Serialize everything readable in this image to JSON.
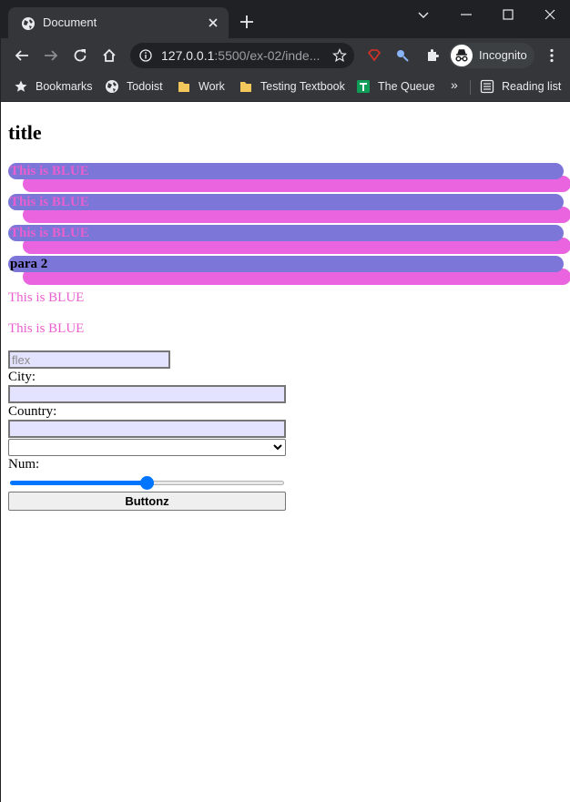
{
  "browser": {
    "tab_title": "Document",
    "url_host": "127.0.0.1",
    "url_rest": ":5500/ex-02/inde...",
    "profile_label": "Incognito",
    "bookmarks": [
      {
        "label": "Bookmarks",
        "icon": "star-icon"
      },
      {
        "label": "Todoist",
        "icon": "globe-icon"
      },
      {
        "label": "Work",
        "icon": "folder-icon"
      },
      {
        "label": "Testing Textbook",
        "icon": "folder-icon"
      },
      {
        "label": "The Queue",
        "icon": "sheets-icon"
      }
    ],
    "more_label": "»",
    "reading_list_label": "Reading list"
  },
  "page": {
    "title": "title",
    "highlight_rows": [
      {
        "text": "This is BLUE"
      },
      {
        "text": "This is BLUE"
      },
      {
        "text": "This is BLUE"
      },
      {
        "text": "para 2"
      }
    ],
    "plain_rows": [
      {
        "text": "This is BLUE"
      },
      {
        "text": "This is BLUE"
      }
    ],
    "form": {
      "flex_placeholder": "flex",
      "city_label": "City:",
      "country_label": "Country:",
      "num_label": "Num:",
      "slider_fraction": 0.5,
      "button_label": "Buttonz"
    }
  },
  "colors": {
    "bar_blue": "#7c76d8",
    "bar_pink": "#e964de",
    "text_pink": "#ea5fcf",
    "input_bg": "#e3e3ff",
    "slider_accent": "#0075ff"
  }
}
